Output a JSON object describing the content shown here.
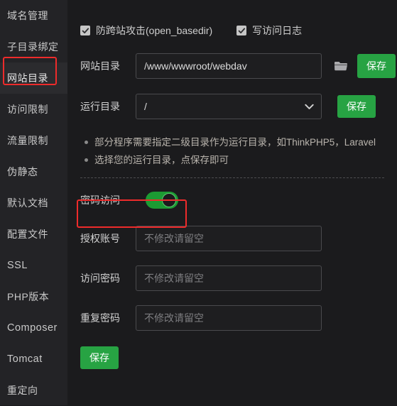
{
  "sidebar": {
    "items": [
      {
        "label": "域名管理",
        "active": false,
        "latin": false
      },
      {
        "label": "子目录绑定",
        "active": false,
        "latin": false
      },
      {
        "label": "网站目录",
        "active": true,
        "latin": false
      },
      {
        "label": "访问限制",
        "active": false,
        "latin": false
      },
      {
        "label": "流量限制",
        "active": false,
        "latin": false
      },
      {
        "label": "伪静态",
        "active": false,
        "latin": false
      },
      {
        "label": "默认文档",
        "active": false,
        "latin": false
      },
      {
        "label": "配置文件",
        "active": false,
        "latin": false
      },
      {
        "label": "SSL",
        "active": false,
        "latin": true
      },
      {
        "label": "PHP版本",
        "active": false,
        "latin": false
      },
      {
        "label": "Composer",
        "active": false,
        "latin": true
      },
      {
        "label": "Tomcat",
        "active": false,
        "latin": true
      },
      {
        "label": "重定向",
        "active": false,
        "latin": false
      }
    ]
  },
  "checkboxes": [
    {
      "label": "防跨站攻击(open_basedir)",
      "checked": true
    },
    {
      "label": "写访问日志",
      "checked": true
    }
  ],
  "website_dir": {
    "label": "网站目录",
    "value": "/www/wwwroot/webdav",
    "placeholder": "",
    "folder_icon": "folder-icon",
    "save_label": "保存"
  },
  "run_dir": {
    "label": "运行目录",
    "value": "/",
    "options": [
      "/"
    ],
    "chevron_icon": "chevron-down-icon",
    "save_label": "保存"
  },
  "tips": [
    "部分程序需要指定二级目录作为运行目录，如ThinkPHP5，Laravel",
    "选择您的运行目录，点保存即可"
  ],
  "password_access": {
    "label": "密码访问",
    "enabled": true
  },
  "credentials": [
    {
      "label": "授权账号",
      "value": "",
      "placeholder": "不修改请留空",
      "type": "text"
    },
    {
      "label": "访问密码",
      "value": "",
      "placeholder": "不修改请留空",
      "type": "text"
    },
    {
      "label": "重复密码",
      "value": "",
      "placeholder": "不修改请留空",
      "type": "text"
    }
  ],
  "bottom_save": {
    "label": "保存"
  },
  "colors": {
    "accent_green": "#27a343",
    "toggle_green": "#1c9b33",
    "annotation_red": "#ee2b2b",
    "sidebar_bg": "#232326",
    "main_bg": "#1b1b1d"
  }
}
